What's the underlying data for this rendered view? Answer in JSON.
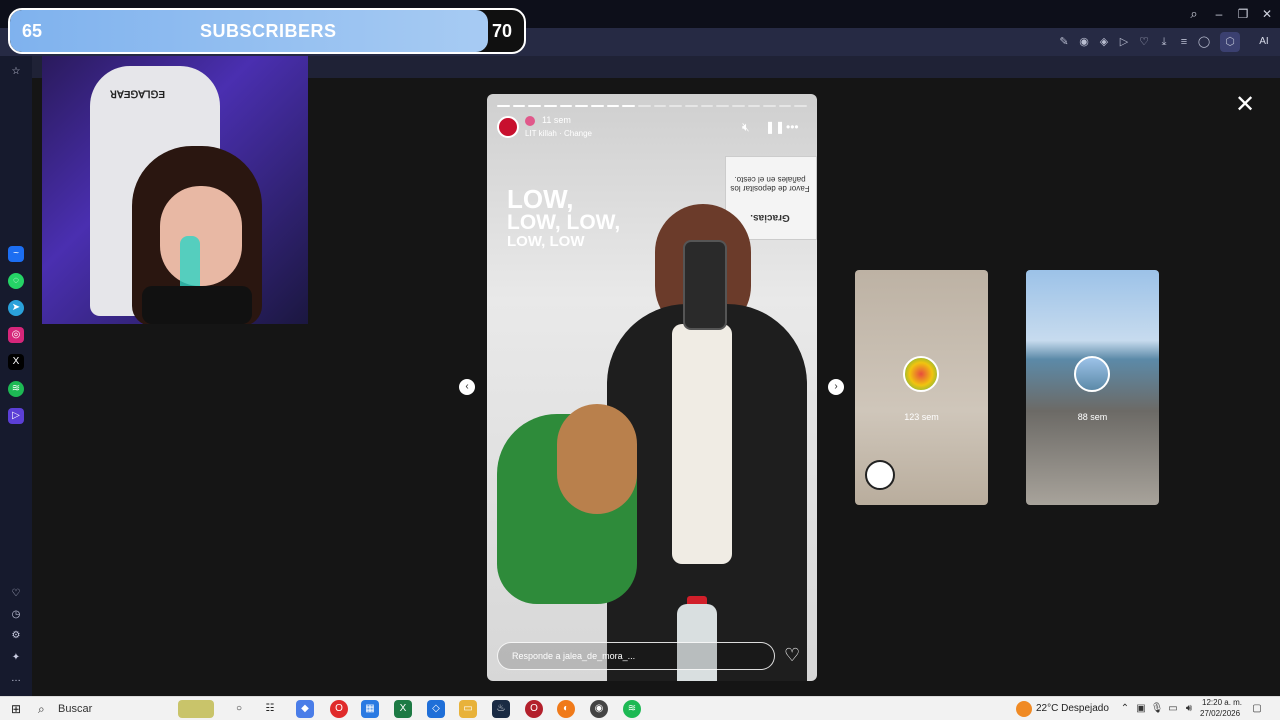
{
  "overlay": {
    "sub_current": "65",
    "sub_label": "SUBSCRIBERS",
    "sub_goal": "70",
    "sub_progress": 0.93
  },
  "webcam": {
    "chair_text": "ꓤ∀Ǝ⅁∀Ꞁ⅁Ǝ"
  },
  "story": {
    "time": "11 sem",
    "song": "LIT killah · Change",
    "text_line1": "LOW,",
    "text_line2": "LOW, LOW,",
    "text_line3": "LOW, LOW",
    "sign_top": "Favor de depositar los pañales en el cesto.",
    "sign_bottom": "Gracias.",
    "reply_placeholder": "Responde a jalea_de_mora_...",
    "progress_segments": 20,
    "progress_done": 9
  },
  "previews": [
    {
      "time": "123 sem"
    },
    {
      "time": "88 sem"
    }
  ],
  "taskbar": {
    "search_label": "Buscar",
    "weather": "22°C  Despejado",
    "time": "12:20 a. m.",
    "date": "27/02/2026"
  },
  "colors": {
    "subbar_fill": "#8fbcf0",
    "toolbar_bg": "#262a44",
    "sidebar_bg": "#161a2d"
  }
}
